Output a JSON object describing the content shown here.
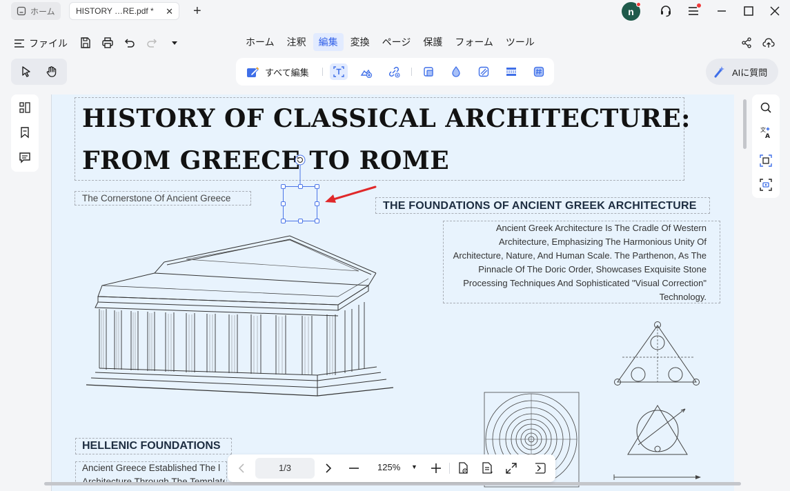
{
  "tabs": [
    {
      "label": "ホーム"
    },
    {
      "label": "HISTORY …RE.pdf *"
    }
  ],
  "user": {
    "initial": "n"
  },
  "menubar": {
    "file_label": "ファイル",
    "items": [
      "ホーム",
      "注釈",
      "編集",
      "変換",
      "ページ",
      "保護",
      "フォーム",
      "ツール"
    ],
    "active": "編集"
  },
  "toolbar": {
    "edit_all_label": "すべて編集",
    "ai_label": "AIに質問"
  },
  "document": {
    "title_line1": "HISTORY OF CLASSICAL  ARCHITECTURE:",
    "title_line2": "FROM GREECE TO ROME",
    "subtitle": "The Cornerstone Of Ancient Greece",
    "section_heading": "THE FOUNDATIONS OF ANCIENT GREEK ARCHITECTURE",
    "section_paragraph": "Ancient Greek Architecture Is The Cradle Of Western Architecture, Emphasizing The Harmonious Unity Of Architecture, Nature, And Human Scale. The Parthenon, As The Pinnacle Of The Doric Order, Showcases Exquisite Stone Processing Techniques And Sophisticated \"Visual Correction\" Technology.",
    "hellenic_heading": "HELLENIC FOUNDATIONS",
    "hellenic_body_line1": "Ancient Greece Established The l",
    "hellenic_body_line2": "Architecture Through The Template"
  },
  "pagebar": {
    "page": "1/3",
    "zoom": "125%"
  },
  "colors": {
    "accent": "#3563e9",
    "page_bg": "#e8f3fd",
    "avatar": "#1f5a4b",
    "notify": "#f03a3a",
    "arrow": "#e0282a"
  }
}
